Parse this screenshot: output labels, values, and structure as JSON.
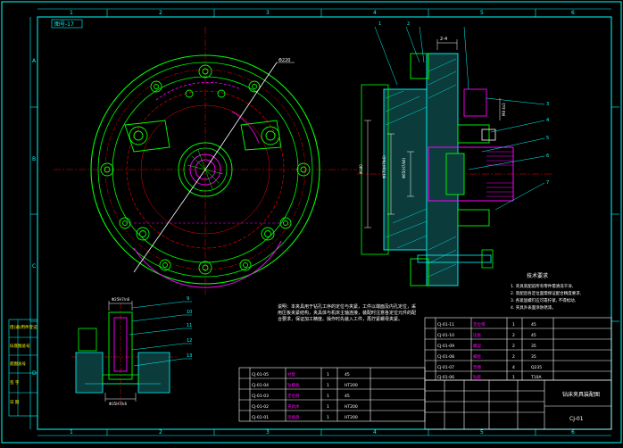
{
  "drawing": {
    "title_tag": "图号-17",
    "diameter_label": "Φ220",
    "dim_2_4": "2-4",
    "dim_left_1": "Φ180",
    "dim_left_2": "Φ170(H7/k6)",
    "dim_left_3": "Φ65(H7/k6)",
    "dim_right_1": "M8 4x3",
    "fit_top": "Φ25H7/n6",
    "fit_bottom": "Φ35H7/k6",
    "tech_title": "技术要求",
    "tech_lines": [
      "1. 夹具装配前所有零件需清洗干净,",
      "2. 装配后各定位面需保证配合精度要求,",
      "3. 各紧固螺钉应可靠拧紧, 不得松动,",
      "4. 夹具外表面涂防锈漆。"
    ],
    "center_note": "说明：本夹具用于钻孔工序的定位与夹紧，工件以端面及内孔定位，采用压板夹紧结构，夹具体与机床主轴连接，装配时注意各定位元件的配合要求，保证加工精度。操作时先装入工件，再拧紧螺母夹紧。",
    "title_block_name": "钻床夹具装配图",
    "title_block_code": "CJ-01",
    "left_stamps": [
      "借(通)用件登记",
      "旧底图总号",
      "底图总号",
      "签 字",
      "日 期"
    ],
    "parts_right": [
      {
        "no": "CJ-01-11",
        "name": "定位销",
        "qty": "1",
        "mat": "45"
      },
      {
        "no": "CJ-01-10",
        "name": "压板",
        "qty": "2",
        "mat": "45"
      },
      {
        "no": "CJ-01-09",
        "name": "螺母",
        "qty": "2",
        "mat": "35"
      },
      {
        "no": "CJ-01-08",
        "name": "螺栓",
        "qty": "2",
        "mat": "35"
      },
      {
        "no": "CJ-01-07",
        "name": "垫圈",
        "qty": "4",
        "mat": "Q235"
      },
      {
        "no": "CJ-01-06",
        "name": "钻套",
        "qty": "1",
        "mat": "T10A"
      }
    ],
    "parts_bottom": [
      {
        "no": "CJ-01-05",
        "name": "衬套",
        "qty": "1",
        "mat": "45"
      },
      {
        "no": "CJ-01-04",
        "name": "钻模板",
        "qty": "1",
        "mat": "HT200"
      },
      {
        "no": "CJ-01-03",
        "name": "定位盘",
        "qty": "1",
        "mat": "45"
      },
      {
        "no": "CJ-01-02",
        "name": "夹具体",
        "qty": "1",
        "mat": "HT200"
      },
      {
        "no": "CJ-01-01",
        "name": "连接盘",
        "qty": "1",
        "mat": "HT200"
      }
    ],
    "balloons_right": [
      "1",
      "2",
      "3",
      "4",
      "5",
      "6",
      "7"
    ],
    "balloons_left": [
      "9",
      "10",
      "11",
      "12",
      "13"
    ],
    "colors": {
      "bg": "#000000",
      "frame": "#00ffff",
      "green": "#00ff00",
      "red": "#ff0000",
      "magenta": "#ff00ff",
      "white": "#ffffff",
      "yellow": "#ffff00"
    }
  }
}
